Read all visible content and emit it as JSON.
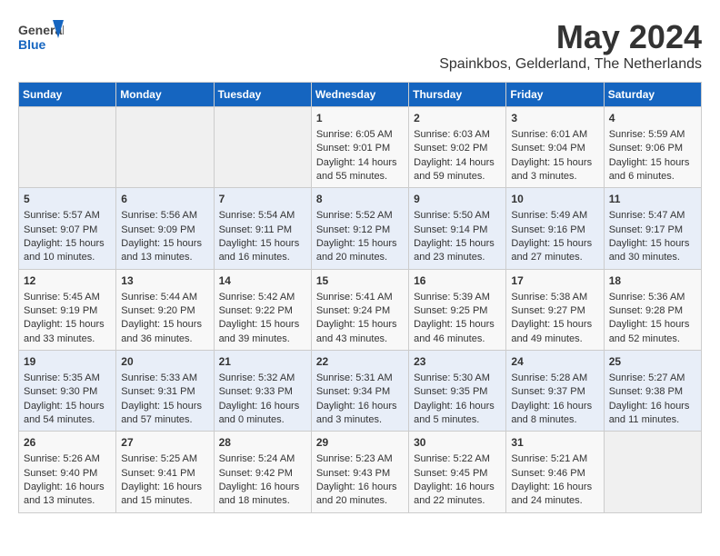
{
  "logo": {
    "line1": "General",
    "line2": "Blue"
  },
  "title": "May 2024",
  "location": "Spainkbos, Gelderland, The Netherlands",
  "weekdays": [
    "Sunday",
    "Monday",
    "Tuesday",
    "Wednesday",
    "Thursday",
    "Friday",
    "Saturday"
  ],
  "weeks": [
    [
      {
        "day": "",
        "content": ""
      },
      {
        "day": "",
        "content": ""
      },
      {
        "day": "",
        "content": ""
      },
      {
        "day": "1",
        "content": "Sunrise: 6:05 AM\nSunset: 9:01 PM\nDaylight: 14 hours\nand 55 minutes."
      },
      {
        "day": "2",
        "content": "Sunrise: 6:03 AM\nSunset: 9:02 PM\nDaylight: 14 hours\nand 59 minutes."
      },
      {
        "day": "3",
        "content": "Sunrise: 6:01 AM\nSunset: 9:04 PM\nDaylight: 15 hours\nand 3 minutes."
      },
      {
        "day": "4",
        "content": "Sunrise: 5:59 AM\nSunset: 9:06 PM\nDaylight: 15 hours\nand 6 minutes."
      }
    ],
    [
      {
        "day": "5",
        "content": "Sunrise: 5:57 AM\nSunset: 9:07 PM\nDaylight: 15 hours\nand 10 minutes."
      },
      {
        "day": "6",
        "content": "Sunrise: 5:56 AM\nSunset: 9:09 PM\nDaylight: 15 hours\nand 13 minutes."
      },
      {
        "day": "7",
        "content": "Sunrise: 5:54 AM\nSunset: 9:11 PM\nDaylight: 15 hours\nand 16 minutes."
      },
      {
        "day": "8",
        "content": "Sunrise: 5:52 AM\nSunset: 9:12 PM\nDaylight: 15 hours\nand 20 minutes."
      },
      {
        "day": "9",
        "content": "Sunrise: 5:50 AM\nSunset: 9:14 PM\nDaylight: 15 hours\nand 23 minutes."
      },
      {
        "day": "10",
        "content": "Sunrise: 5:49 AM\nSunset: 9:16 PM\nDaylight: 15 hours\nand 27 minutes."
      },
      {
        "day": "11",
        "content": "Sunrise: 5:47 AM\nSunset: 9:17 PM\nDaylight: 15 hours\nand 30 minutes."
      }
    ],
    [
      {
        "day": "12",
        "content": "Sunrise: 5:45 AM\nSunset: 9:19 PM\nDaylight: 15 hours\nand 33 minutes."
      },
      {
        "day": "13",
        "content": "Sunrise: 5:44 AM\nSunset: 9:20 PM\nDaylight: 15 hours\nand 36 minutes."
      },
      {
        "day": "14",
        "content": "Sunrise: 5:42 AM\nSunset: 9:22 PM\nDaylight: 15 hours\nand 39 minutes."
      },
      {
        "day": "15",
        "content": "Sunrise: 5:41 AM\nSunset: 9:24 PM\nDaylight: 15 hours\nand 43 minutes."
      },
      {
        "day": "16",
        "content": "Sunrise: 5:39 AM\nSunset: 9:25 PM\nDaylight: 15 hours\nand 46 minutes."
      },
      {
        "day": "17",
        "content": "Sunrise: 5:38 AM\nSunset: 9:27 PM\nDaylight: 15 hours\nand 49 minutes."
      },
      {
        "day": "18",
        "content": "Sunrise: 5:36 AM\nSunset: 9:28 PM\nDaylight: 15 hours\nand 52 minutes."
      }
    ],
    [
      {
        "day": "19",
        "content": "Sunrise: 5:35 AM\nSunset: 9:30 PM\nDaylight: 15 hours\nand 54 minutes."
      },
      {
        "day": "20",
        "content": "Sunrise: 5:33 AM\nSunset: 9:31 PM\nDaylight: 15 hours\nand 57 minutes."
      },
      {
        "day": "21",
        "content": "Sunrise: 5:32 AM\nSunset: 9:33 PM\nDaylight: 16 hours\nand 0 minutes."
      },
      {
        "day": "22",
        "content": "Sunrise: 5:31 AM\nSunset: 9:34 PM\nDaylight: 16 hours\nand 3 minutes."
      },
      {
        "day": "23",
        "content": "Sunrise: 5:30 AM\nSunset: 9:35 PM\nDaylight: 16 hours\nand 5 minutes."
      },
      {
        "day": "24",
        "content": "Sunrise: 5:28 AM\nSunset: 9:37 PM\nDaylight: 16 hours\nand 8 minutes."
      },
      {
        "day": "25",
        "content": "Sunrise: 5:27 AM\nSunset: 9:38 PM\nDaylight: 16 hours\nand 11 minutes."
      }
    ],
    [
      {
        "day": "26",
        "content": "Sunrise: 5:26 AM\nSunset: 9:40 PM\nDaylight: 16 hours\nand 13 minutes."
      },
      {
        "day": "27",
        "content": "Sunrise: 5:25 AM\nSunset: 9:41 PM\nDaylight: 16 hours\nand 15 minutes."
      },
      {
        "day": "28",
        "content": "Sunrise: 5:24 AM\nSunset: 9:42 PM\nDaylight: 16 hours\nand 18 minutes."
      },
      {
        "day": "29",
        "content": "Sunrise: 5:23 AM\nSunset: 9:43 PM\nDaylight: 16 hours\nand 20 minutes."
      },
      {
        "day": "30",
        "content": "Sunrise: 5:22 AM\nSunset: 9:45 PM\nDaylight: 16 hours\nand 22 minutes."
      },
      {
        "day": "31",
        "content": "Sunrise: 5:21 AM\nSunset: 9:46 PM\nDaylight: 16 hours\nand 24 minutes."
      },
      {
        "day": "",
        "content": ""
      }
    ]
  ]
}
